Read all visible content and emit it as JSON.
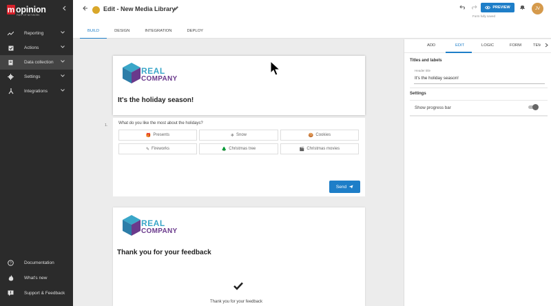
{
  "sidebar": {
    "logo_letter": "m",
    "logo_text": "opinion",
    "logo_sub": "PART OF NETWORK",
    "items": [
      {
        "label": "Reporting",
        "icon": "chart-line-icon"
      },
      {
        "label": "Actions",
        "icon": "checkbox-icon"
      },
      {
        "label": "Data collection",
        "icon": "clipboard-icon"
      },
      {
        "label": "Settings",
        "icon": "gear-icon"
      },
      {
        "label": "Integrations",
        "icon": "plug-icon"
      }
    ],
    "bottom": [
      {
        "label": "Documentation",
        "icon": "help-circle-icon"
      },
      {
        "label": "What's new",
        "icon": "flame-icon"
      },
      {
        "label": "Support & Feedback",
        "icon": "chat-alert-icon"
      }
    ]
  },
  "header": {
    "title": "Edit - New Media Library",
    "saved_status": "Form fully saved",
    "preview_label": "PREVIEW",
    "avatar_initials": "JV",
    "tabs": [
      "BUILD",
      "DESIGN",
      "INTEGRATION",
      "DEPLOY"
    ],
    "active_tab": "BUILD"
  },
  "canvas": {
    "card1": {
      "logo_line1": "REAL",
      "logo_line2": "COMPANY",
      "title": "It's the holiday season!"
    },
    "question": {
      "number": "1.",
      "text": "What do you like the most about the holidays?",
      "options": [
        {
          "label": "Presents",
          "icon": "gift-icon"
        },
        {
          "label": "Snow",
          "icon": "snowflake-icon"
        },
        {
          "label": "Cookies",
          "icon": "cookie-icon"
        },
        {
          "label": "Fireworks",
          "icon": "firework-icon"
        },
        {
          "label": "Christmas tree",
          "icon": "tree-icon"
        },
        {
          "label": "Christmas movies",
          "icon": "film-icon"
        }
      ],
      "send_label": "Send"
    },
    "card2": {
      "logo_line1": "REAL",
      "logo_line2": "COMPANY",
      "title": "Thank you for your feedback",
      "message": "Thank you for your feedback"
    }
  },
  "panel": {
    "tabs": [
      "ADD",
      "EDIT",
      "LOGIC",
      "FORM",
      "TEM"
    ],
    "active_tab": "EDIT",
    "titles_section": "Titles and labels",
    "header_title_label": "Header title",
    "header_title_value": "It's the holiday season!",
    "settings_section": "Settings",
    "progress_label": "Show progress bar",
    "progress_enabled": false
  },
  "colors": {
    "accent": "#1e7ec8",
    "sidebar_bg": "#2b2b2b",
    "logo_red": "#d6202a"
  }
}
